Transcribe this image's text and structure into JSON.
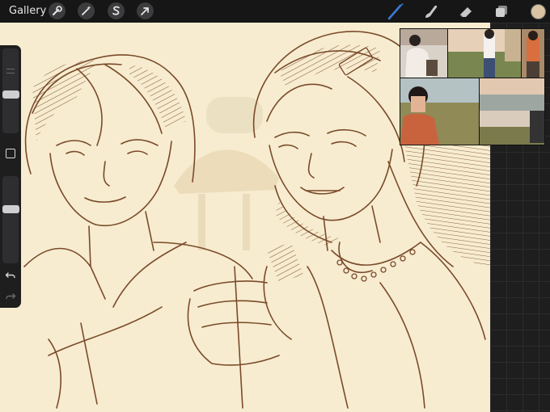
{
  "header": {
    "gallery_label": "Gallery"
  },
  "toolbar_left": [
    "wrench-icon",
    "magic-wand-icon",
    "selection-s-icon",
    "transform-arrow-icon"
  ],
  "toolbar_right": [
    "brush-icon",
    "smudge-icon",
    "eraser-icon",
    "layers-icon",
    "color-swatch"
  ],
  "colors": {
    "active_color": "#d9c3a3",
    "canvas": "#f7ecd0",
    "ink": "#7a4a2a",
    "brush_active": "#3a7bd5"
  },
  "sidebar": {
    "brush_size_level": 0.46,
    "opacity_level": 0.62
  }
}
